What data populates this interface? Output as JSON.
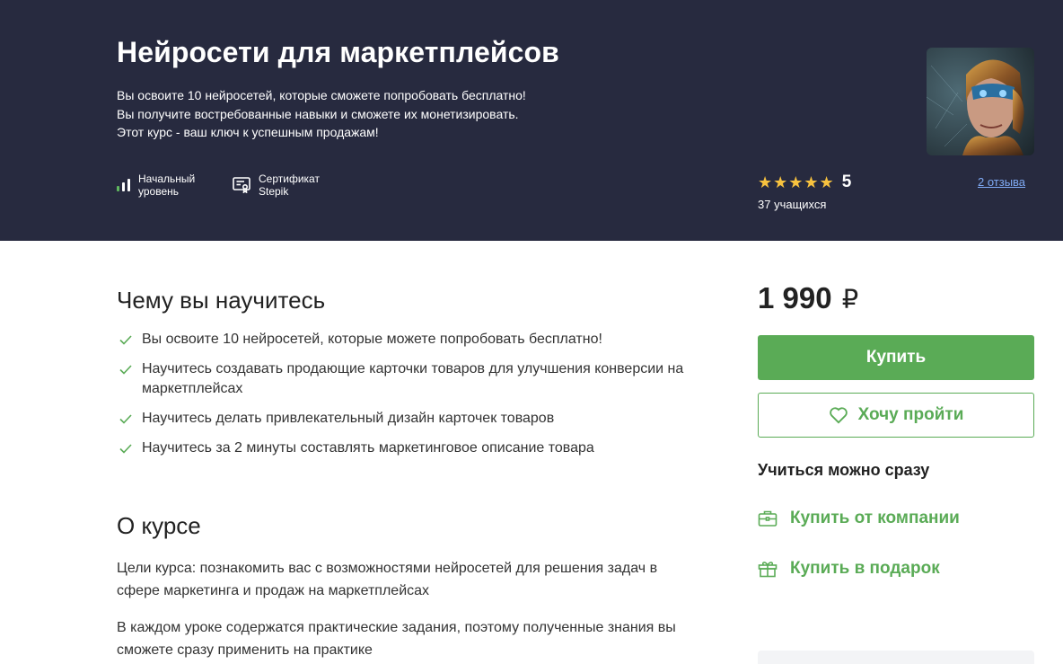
{
  "hero": {
    "title": "Нейросети для маркетплейсов",
    "description": [
      "Вы освоите 10 нейросетей, которые сможете попробовать бесплатно!",
      "Вы получите востребованные навыки и сможете их монетизировать.",
      "Этот курс - ваш ключ к успешным продажам!"
    ],
    "level_line1": "Начальный",
    "level_line2": "уровень",
    "cert_line1": "Сертификат",
    "cert_line2": "Stepik",
    "stars": "★★★★★",
    "rating": "5",
    "students": "37 учащихся",
    "reviews": "2 отзыва",
    "icons": {
      "level": "level-bars-icon",
      "certificate": "certificate-icon",
      "cover": "course-cover-image"
    }
  },
  "learn": {
    "title": "Чему вы научитесь",
    "items": [
      "Вы освоите 10 нейросетей, которые можете попробовать бесплатно!",
      "Научитесь создавать продающие карточки товаров для улучшения конверсии на маркетплейсах",
      "Научитесь делать привлекательный дизайн карточек товаров",
      "Научитесь за 2 минуты составлять маркетинговое описание товара"
    ]
  },
  "about": {
    "title": "О курсе",
    "paragraphs": [
      "Цели курса: познакомить вас с возможностями нейросетей для решения задач в сфере маркетинга и продаж на маркетплейсах",
      "В каждом уроке содержатся практические задания, поэтому полученные знания вы сможете сразу применить на практике"
    ]
  },
  "sidebar": {
    "price": "1 990",
    "currency": "₽",
    "buy_label": "Купить",
    "wish_label": "Хочу пройти",
    "start_now": "Учиться можно сразу",
    "company_label": "Купить от компании",
    "gift_label": "Купить в подарок"
  },
  "colors": {
    "hero_bg": "#272a3f",
    "accent_green": "#5aab56",
    "star": "#f7c23f",
    "link_blue": "#7faaf4"
  }
}
